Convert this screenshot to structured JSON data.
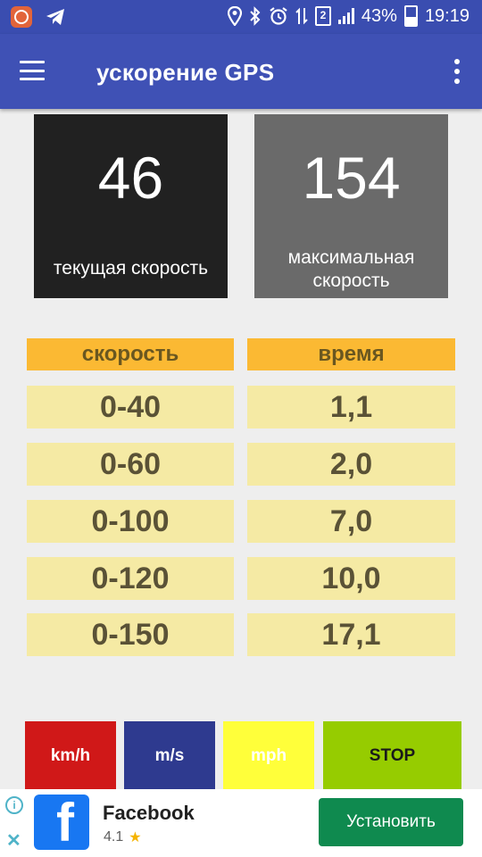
{
  "status_bar": {
    "icons": [
      "app-notification-icon",
      "telegram-icon",
      "location-icon",
      "bluetooth-icon",
      "alarm-icon",
      "data-transfer-icon",
      "sim-icon",
      "signal-icon",
      "battery-icon"
    ],
    "sim_slot": "2",
    "battery": "43%",
    "battery_level": 0.43,
    "time": "19:19"
  },
  "app_bar": {
    "title": "ускорение GPS",
    "background": "#3f51b5"
  },
  "speed": {
    "current_value": "46",
    "current_label": "текущая скорость",
    "max_value": "154",
    "max_label": "максимальная скорость"
  },
  "table": {
    "headers": [
      "скорость",
      "время"
    ],
    "rows": [
      {
        "speed": "0-40",
        "time": "1,1"
      },
      {
        "speed": "0-60",
        "time": "2,0"
      },
      {
        "speed": "0-100",
        "time": "7,0"
      },
      {
        "speed": "0-120",
        "time": "10,0"
      },
      {
        "speed": "0-150",
        "time": "17,1"
      }
    ]
  },
  "units": {
    "kmh": "km/h",
    "ms": "m/s",
    "mph": "mph",
    "stop": "STOP"
  },
  "ad": {
    "app_name": "Facebook",
    "rating": "4.1",
    "install_label": "Установить",
    "logo_letter": "f"
  },
  "colors": {
    "header_cell": "#fbb933",
    "row_cell": "#f5eaa4",
    "kmh": "#d01818",
    "ms": "#2e3a8f",
    "mph": "#ffff3a",
    "stop": "#96cc00",
    "install": "#0f8a4f"
  }
}
